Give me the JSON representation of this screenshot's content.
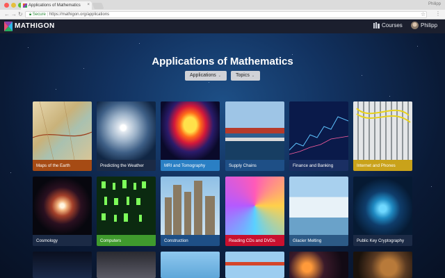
{
  "browser": {
    "tab_title": "Applications of Mathematics",
    "tab_close": "×",
    "profile_name": "Philipp",
    "secure_label": "Secure",
    "url": "https://mathigon.org/applications",
    "icons": [
      "back-arrow-icon",
      "forward-arrow-icon",
      "reload-icon",
      "lock-icon",
      "star-icon",
      "menu-dots-icon"
    ]
  },
  "header": {
    "logo_text": "MATHIGON",
    "courses_label": "Courses",
    "user_name": "Philipp"
  },
  "main": {
    "title": "Applications of Mathematics",
    "filters": [
      {
        "label": "Applications"
      },
      {
        "label": "Topics"
      }
    ],
    "caret": "⌄"
  },
  "cards": [
    {
      "label": "Maps of the Earth",
      "color": "#a64b14"
    },
    {
      "label": "Predicting the Weather",
      "color": "#1b2a45"
    },
    {
      "label": "MRI and Tomography",
      "color": "#2a7fc4"
    },
    {
      "label": "Supply Chains",
      "color": "#1e4f86"
    },
    {
      "label": "Finance and Banking",
      "color": "#1a2f63"
    },
    {
      "label": "Internet and Phones",
      "color": "#c9a21a"
    },
    {
      "label": "Cosmology",
      "color": "#1b2a45"
    },
    {
      "label": "Computers",
      "color": "#3f9a2d"
    },
    {
      "label": "Construction",
      "color": "#1e4f86"
    },
    {
      "label": "Reading CDs and DVDs",
      "color": "#c8102e"
    },
    {
      "label": "Glacier Melting",
      "color": "#2c5a86"
    },
    {
      "label": "Public Key Cryptography",
      "color": "#1b2a45"
    }
  ]
}
